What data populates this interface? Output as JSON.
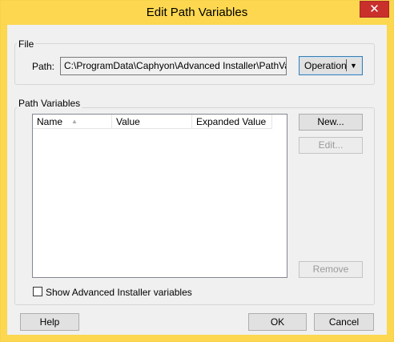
{
  "window": {
    "title": "Edit Path Variables",
    "close_glyph": "✕"
  },
  "file_group": {
    "label": "File",
    "path_label": "Path:",
    "path_value": "C:\\ProgramData\\Caphyon\\Advanced Installer\\PathVariab",
    "operation_label": "Operation",
    "dropdown_glyph": "▼"
  },
  "path_group": {
    "label": "Path Variables",
    "columns": [
      "Name",
      "Value",
      "Expanded Value"
    ],
    "sort_glyph": "▲",
    "new_label": "New...",
    "edit_label": "Edit...",
    "remove_label": "Remove",
    "show_checkbox_label": "Show Advanced Installer variables"
  },
  "footer": {
    "help_label": "Help",
    "ok_label": "OK",
    "cancel_label": "Cancel"
  }
}
